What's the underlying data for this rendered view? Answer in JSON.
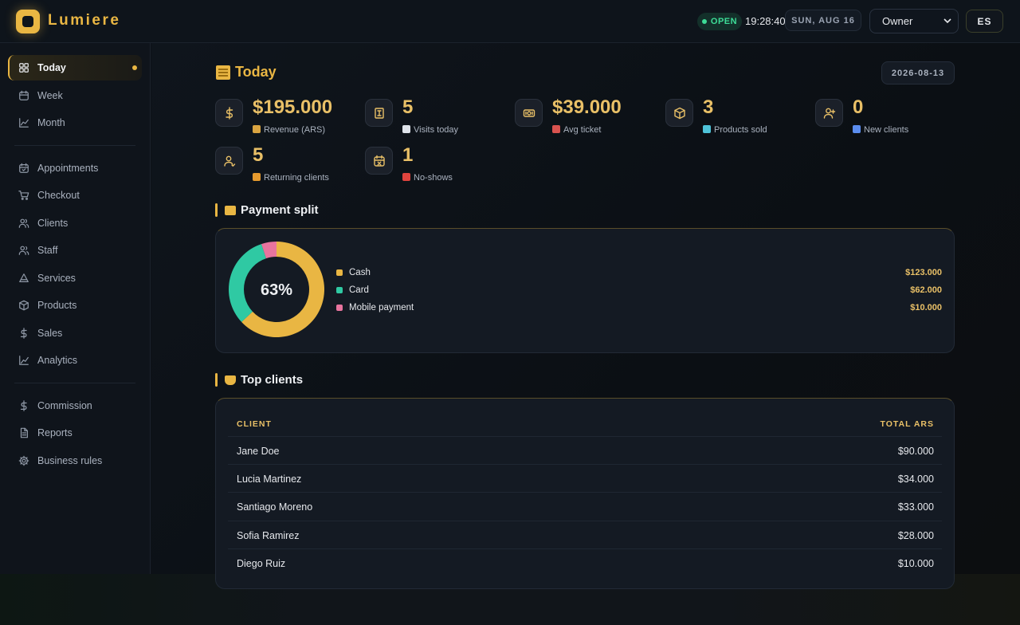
{
  "app": {
    "name": "Lumiere"
  },
  "header": {
    "status": "OPEN",
    "clock": "19:28:40",
    "date": "SUN, AUG 16",
    "role": "Owner",
    "lang": "ES"
  },
  "sidebar": {
    "groups": [
      [
        {
          "label": "Today",
          "icon": "grid-icon",
          "active": true
        },
        {
          "label": "Week",
          "icon": "calendar-icon"
        },
        {
          "label": "Month",
          "icon": "line-chart-icon"
        }
      ],
      [
        {
          "label": "Appointments",
          "icon": "calendar-check-icon"
        },
        {
          "label": "Checkout",
          "icon": "cart-icon"
        },
        {
          "label": "Clients",
          "icon": "users-icon"
        },
        {
          "label": "Staff",
          "icon": "staff-icon"
        },
        {
          "label": "Services",
          "icon": "triangle-icon"
        },
        {
          "label": "Products",
          "icon": "box-icon"
        },
        {
          "label": "Sales",
          "icon": "dollar-icon"
        },
        {
          "label": "Analytics",
          "icon": "trend-icon"
        }
      ],
      [
        {
          "label": "Commission",
          "icon": "dollar-icon"
        },
        {
          "label": "Reports",
          "icon": "document-icon"
        },
        {
          "label": "Business rules",
          "icon": "gear-icon"
        }
      ]
    ]
  },
  "page": {
    "title": "Today",
    "date": "2026-08-13"
  },
  "kpis": [
    {
      "value": "$195.000",
      "label": "Revenue (ARS)",
      "icon": "dollar-icon",
      "emoji": "money-bag",
      "emoji_color": "#d9a441"
    },
    {
      "value": "5",
      "label": "Visits today",
      "icon": "receipt-icon",
      "emoji": "receipt",
      "emoji_color": "#dfe3ea"
    },
    {
      "value": "$39.000",
      "label": "Avg ticket",
      "icon": "banknote-icon",
      "emoji": "ticket",
      "emoji_color": "#d9534f"
    },
    {
      "value": "3",
      "label": "Products sold",
      "icon": "box-icon",
      "emoji": "bottle",
      "emoji_color": "#4fc3d9"
    },
    {
      "value": "0",
      "label": "New clients",
      "icon": "user-plus-icon",
      "emoji": "new-badge",
      "emoji_color": "#5b8def"
    },
    {
      "value": "5",
      "label": "Returning clients",
      "icon": "user-icon",
      "emoji": "repeat",
      "emoji_color": "#e59a2e"
    },
    {
      "value": "1",
      "label": "No-shows",
      "icon": "calendar-x-icon",
      "emoji": "prohibited",
      "emoji_color": "#e0443e"
    }
  ],
  "payment_split": {
    "title": "Payment split",
    "center_label": "63%",
    "items": [
      {
        "label": "Cash",
        "amount": "$123.000",
        "value": 123000,
        "color": "#e9b643"
      },
      {
        "label": "Card",
        "amount": "$62.000",
        "value": 62000,
        "color": "#2fc9a3"
      },
      {
        "label": "Mobile payment",
        "amount": "$10.000",
        "value": 10000,
        "color": "#e8749e"
      }
    ]
  },
  "top_clients": {
    "title": "Top clients",
    "columns": [
      "CLIENT",
      "TOTAL ARS"
    ],
    "rows": [
      {
        "client": "Jane Doe",
        "total": "$90.000"
      },
      {
        "client": "Lucia Martinez",
        "total": "$34.000"
      },
      {
        "client": "Santiago Moreno",
        "total": "$33.000"
      },
      {
        "client": "Sofia Ramirez",
        "total": "$28.000"
      },
      {
        "client": "Diego Ruiz",
        "total": "$10.000"
      }
    ]
  },
  "colors": {
    "accent": "#e9b643",
    "open": "#3ddc97",
    "background": "#0d1117"
  }
}
